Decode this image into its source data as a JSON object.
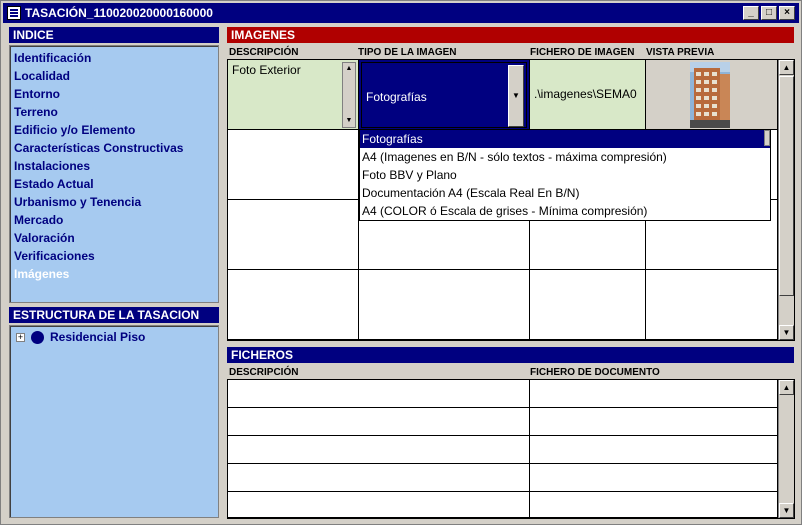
{
  "window": {
    "title": "TASACIÓN_110020020000160000",
    "minimize": "_",
    "maximize": "□",
    "close": "×"
  },
  "indice": {
    "header": "INDICE",
    "items": [
      "Identificación",
      "Localidad",
      "Entorno",
      "Terreno",
      "Edificio y/o Elemento",
      "Características Constructivas",
      "Instalaciones",
      "Estado Actual",
      "Urbanismo y Tenencia",
      "Mercado",
      "Valoración",
      "Verificaciones",
      "Imágenes"
    ],
    "active_item": "Imágenes"
  },
  "estructura": {
    "header": "ESTRUCTURA DE LA TASACION",
    "expander": "+",
    "node_label": "Residencial Piso"
  },
  "imagenes": {
    "header": "IMAGENES",
    "columns": {
      "descripcion": "DESCRIPCIÓN",
      "tipo": "TIPO DE LA IMAGEN",
      "fichero": "FICHERO DE IMAGEN",
      "vista": "VISTA PREVIA"
    },
    "row1": {
      "descripcion": "Foto Exterior",
      "tipo": "Fotografías",
      "fichero": ".\\imagenes\\SEMA0"
    },
    "dropdown_options": [
      "Fotografías",
      "A4 (Imagenes en B/N - sólo textos - máxima compresión)",
      "Foto BBV y Plano",
      "Documentación A4 (Escala Real En B/N)",
      "A4 (COLOR ó Escala de grises - Mínima compresión)"
    ],
    "dropdown_selected": "Fotografías"
  },
  "ficheros": {
    "header": "FICHEROS",
    "columns": {
      "descripcion": "DESCRIPCIÓN",
      "documento": "FICHERO DE DOCUMENTO"
    }
  },
  "colors": {
    "navy": "#000080",
    "panel_blue": "#a6caf0",
    "red_header": "#b00000",
    "cell_green": "#d8e8c8",
    "face": "#d4d0c8"
  },
  "icons": {
    "app": "document-icon",
    "scroll_up": "arrow-up-icon",
    "scroll_down": "arrow-down-icon",
    "combo_arrow": "chevron-down-icon",
    "tree_node": "circle-icon"
  }
}
